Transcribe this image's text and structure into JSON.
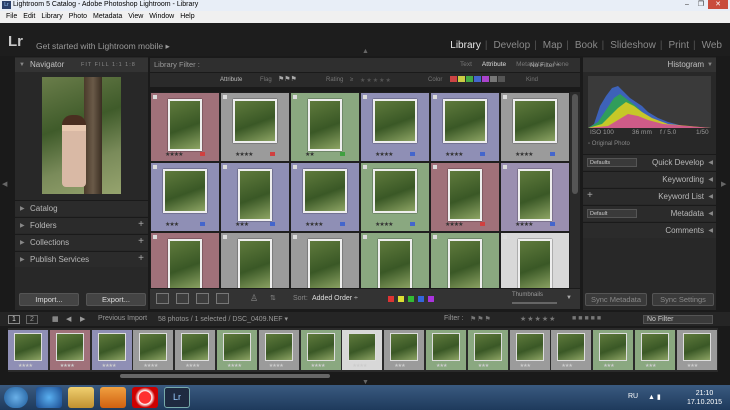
{
  "window": {
    "title": "Lightroom 5 Catalog - Adobe Photoshop Lightroom - Library",
    "icon_label": "Lr"
  },
  "menu": [
    "File",
    "Edit",
    "Library",
    "Photo",
    "Metadata",
    "View",
    "Window",
    "Help"
  ],
  "identity": {
    "logo": "Lr",
    "mobile": "Get started with Lightroom mobile ▸"
  },
  "modules": [
    {
      "label": "Library",
      "active": true
    },
    {
      "label": "Develop",
      "active": false
    },
    {
      "label": "Map",
      "active": false
    },
    {
      "label": "Book",
      "active": false
    },
    {
      "label": "Slideshow",
      "active": false
    },
    {
      "label": "Print",
      "active": false
    },
    {
      "label": "Web",
      "active": false
    }
  ],
  "left": {
    "navigator": {
      "label": "Navigator",
      "zoom": "FIT  FILL  1:1  1:8"
    },
    "sections": [
      "Catalog",
      "Folders",
      "Collections",
      "Publish Services"
    ],
    "import_label": "Import...",
    "export_label": "Export..."
  },
  "filter": {
    "title": "Library Filter :",
    "tabs": [
      "Text",
      "Attribute",
      "Metadata",
      "None"
    ],
    "preset": "No Filter ÷",
    "attribute_label": "Attribute",
    "flag_label": "Flag",
    "rating_label": "Rating",
    "rating_op": "≥",
    "color_label": "Color",
    "kind_label": "Kind"
  },
  "grid": {
    "cells": [
      {
        "bg": "#a0717a",
        "stars": "★★★★",
        "badge": "#d04040"
      },
      {
        "bg": "#9b9b9b",
        "stars": "★★★★",
        "badge": "#d04040"
      },
      {
        "bg": "#8aa880",
        "stars": "★★",
        "badge": "#40a040"
      },
      {
        "bg": "#8f8fb5",
        "stars": "★★★★",
        "badge": "#4466cc"
      },
      {
        "bg": "#8f8fb5",
        "stars": "★★★★",
        "badge": "#4466cc"
      },
      {
        "bg": "#9b9b9b",
        "stars": "★★★★",
        "badge": "#4466cc"
      },
      {
        "bg": "#8f8fb5",
        "stars": "★★★",
        "badge": "#4466cc"
      },
      {
        "bg": "#8f8fb5",
        "stars": "★★★",
        "badge": "#4466cc"
      },
      {
        "bg": "#8f8fb5",
        "stars": "★★★★",
        "badge": "#4466cc"
      },
      {
        "bg": "#8aa880",
        "stars": "★★★★",
        "badge": "#4466cc"
      },
      {
        "bg": "#a0717a",
        "stars": "★★★★",
        "badge": "#d04040"
      },
      {
        "bg": "#9a8fb0",
        "stars": "★★★★",
        "badge": "#4466cc"
      },
      {
        "bg": "#a0717a",
        "stars": "",
        "badge": ""
      },
      {
        "bg": "#9b9b9b",
        "stars": "",
        "badge": ""
      },
      {
        "bg": "#9b9b9b",
        "stars": "",
        "badge": ""
      },
      {
        "bg": "#8aa880",
        "stars": "",
        "badge": ""
      },
      {
        "bg": "#8aa880",
        "stars": "",
        "badge": ""
      },
      {
        "bg": "#d8d8d8",
        "stars": "",
        "badge": ""
      }
    ]
  },
  "toolbar": {
    "sort_label": "Sort:",
    "sort_value": "Added Order ÷",
    "thumbnails_label": "Thumbnails"
  },
  "right": {
    "histogram_label": "Histogram",
    "exif": {
      "iso": "ISO 100",
      "focal": "36 mm",
      "aperture": "f / 5.0",
      "shutter": "1/50"
    },
    "original_photo": "Original Photo",
    "quick_develop": "Quick Develop",
    "qd_preset": "Defaults",
    "keywording": "Keywording",
    "keyword_list": "Keyword List",
    "metadata": "Metadata",
    "metadata_preset": "Default",
    "comments": "Comments",
    "sync_metadata": "Sync Metadata",
    "sync_settings": "Sync Settings"
  },
  "filmstrip": {
    "page1": "1",
    "page2": "2",
    "source": "Previous Import",
    "count": "58 photos / 1 selected / DSC_0409.NEF ▾",
    "filter_label": "Filter :",
    "filter_value": "No Filter",
    "thumbs": [
      {
        "bg": "#8f8fb5",
        "stars": "★★★★"
      },
      {
        "bg": "#a0717a",
        "stars": "★★★★"
      },
      {
        "bg": "#8f8fb5",
        "stars": "★★★★"
      },
      {
        "bg": "#9b9b9b",
        "stars": "★★★★"
      },
      {
        "bg": "#9b9b9b",
        "stars": "★★★★"
      },
      {
        "bg": "#8aa880",
        "stars": "★★★★"
      },
      {
        "bg": "#9b9b9b",
        "stars": "★★★★"
      },
      {
        "bg": "#8aa880",
        "stars": "★★★★"
      },
      {
        "bg": "#d8d8d8",
        "stars": "★★★★"
      },
      {
        "bg": "#9b9b9b",
        "stars": "★★★"
      },
      {
        "bg": "#8aa880",
        "stars": "★★★"
      },
      {
        "bg": "#8aa880",
        "stars": "★★★"
      },
      {
        "bg": "#9b9b9b",
        "stars": "★★★"
      },
      {
        "bg": "#9b9b9b",
        "stars": "★★★"
      },
      {
        "bg": "#8aa880",
        "stars": "★★★"
      },
      {
        "bg": "#8aa880",
        "stars": "★★★"
      },
      {
        "bg": "#9b9b9b",
        "stars": "★★★"
      }
    ]
  },
  "taskbar": {
    "lang": "RU",
    "time": "21:10",
    "date": "17.10.2015"
  }
}
